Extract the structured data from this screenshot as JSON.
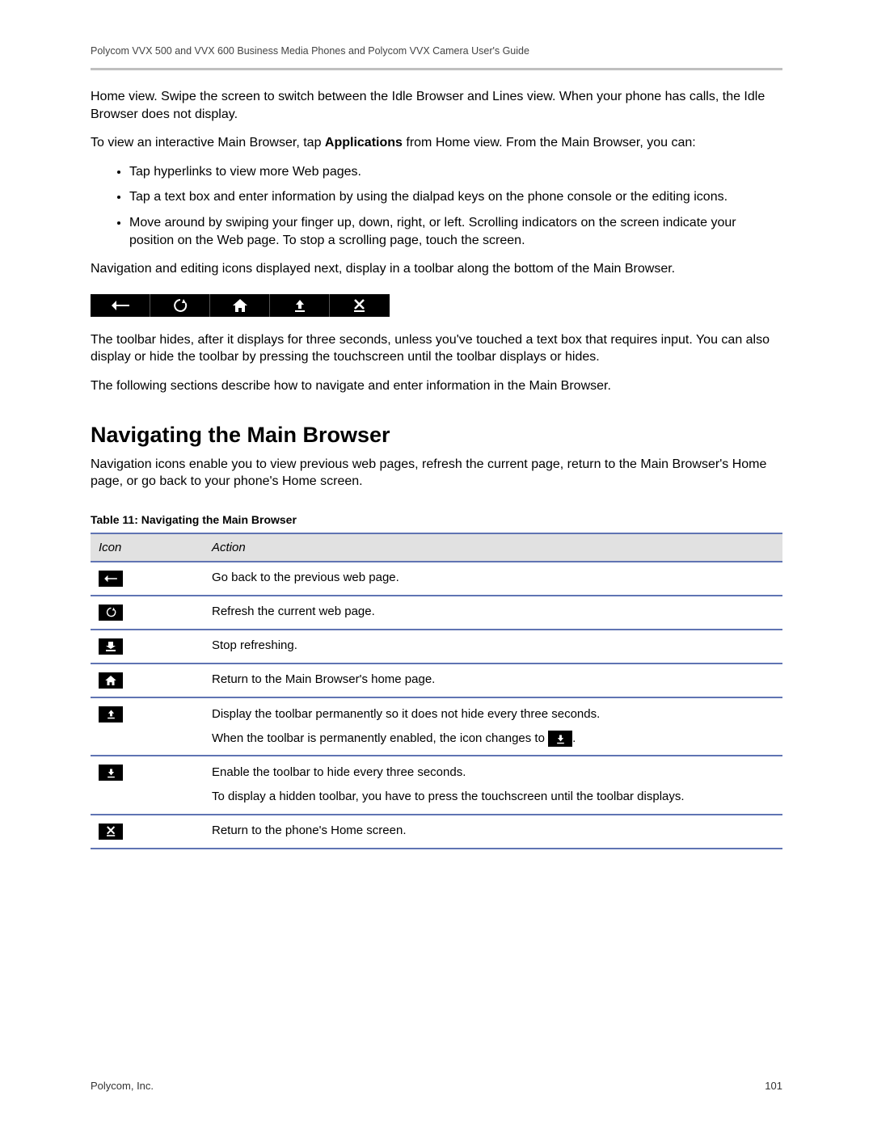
{
  "header": {
    "title": "Polycom VVX 500 and VVX 600 Business Media Phones and Polycom VVX Camera User's Guide"
  },
  "body": {
    "p1": "Home view. Swipe the screen to switch between the Idle Browser and Lines view. When your phone has calls, the Idle Browser does not display.",
    "p2_pre": "To view an interactive Main Browser, tap ",
    "p2_bold": "Applications",
    "p2_post": " from Home view. From the Main Browser, you can:",
    "bullets": [
      "Tap hyperlinks to view more Web pages.",
      "Tap a text box and enter information by using the dialpad keys on the phone console or the editing icons.",
      "Move around by swiping your finger up, down, right, or left. Scrolling indicators on the screen indicate your position on the Web page. To stop a scrolling page, touch the screen."
    ],
    "p3": "Navigation and editing icons displayed next, display in a toolbar along the bottom of the Main Browser.",
    "p4": "The toolbar hides, after it displays for three seconds, unless you've touched a text box that requires input. You can also display or hide the toolbar by pressing the touchscreen until the toolbar displays or hides.",
    "p5": "The following sections describe how to navigate and enter information in the Main Browser."
  },
  "section": {
    "heading": "Navigating the Main Browser",
    "intro": "Navigation icons enable you to view previous web pages, refresh the current page, return to the Main Browser's Home page, or go back to your phone's Home screen."
  },
  "table": {
    "title": "Table 11: Navigating the Main Browser",
    "col_icon": "Icon",
    "col_action": "Action",
    "rows_simple": {
      "r0": "Go back to the previous web page.",
      "r1": "Refresh the current web page.",
      "r2": "Stop refreshing.",
      "r3": "Return to the Main Browser's home page.",
      "r6": "Return to the phone's Home screen."
    },
    "row4": {
      "l1": "Display the toolbar permanently so it does not hide every three seconds.",
      "l2_pre": "When the toolbar is permanently enabled, the icon changes to ",
      "l2_post": "."
    },
    "row5": {
      "l1": "Enable the toolbar to hide every three seconds.",
      "l2": "To display a hidden toolbar, you have to press the touchscreen until the toolbar displays."
    }
  },
  "footer": {
    "company": "Polycom, Inc.",
    "page": "101"
  }
}
